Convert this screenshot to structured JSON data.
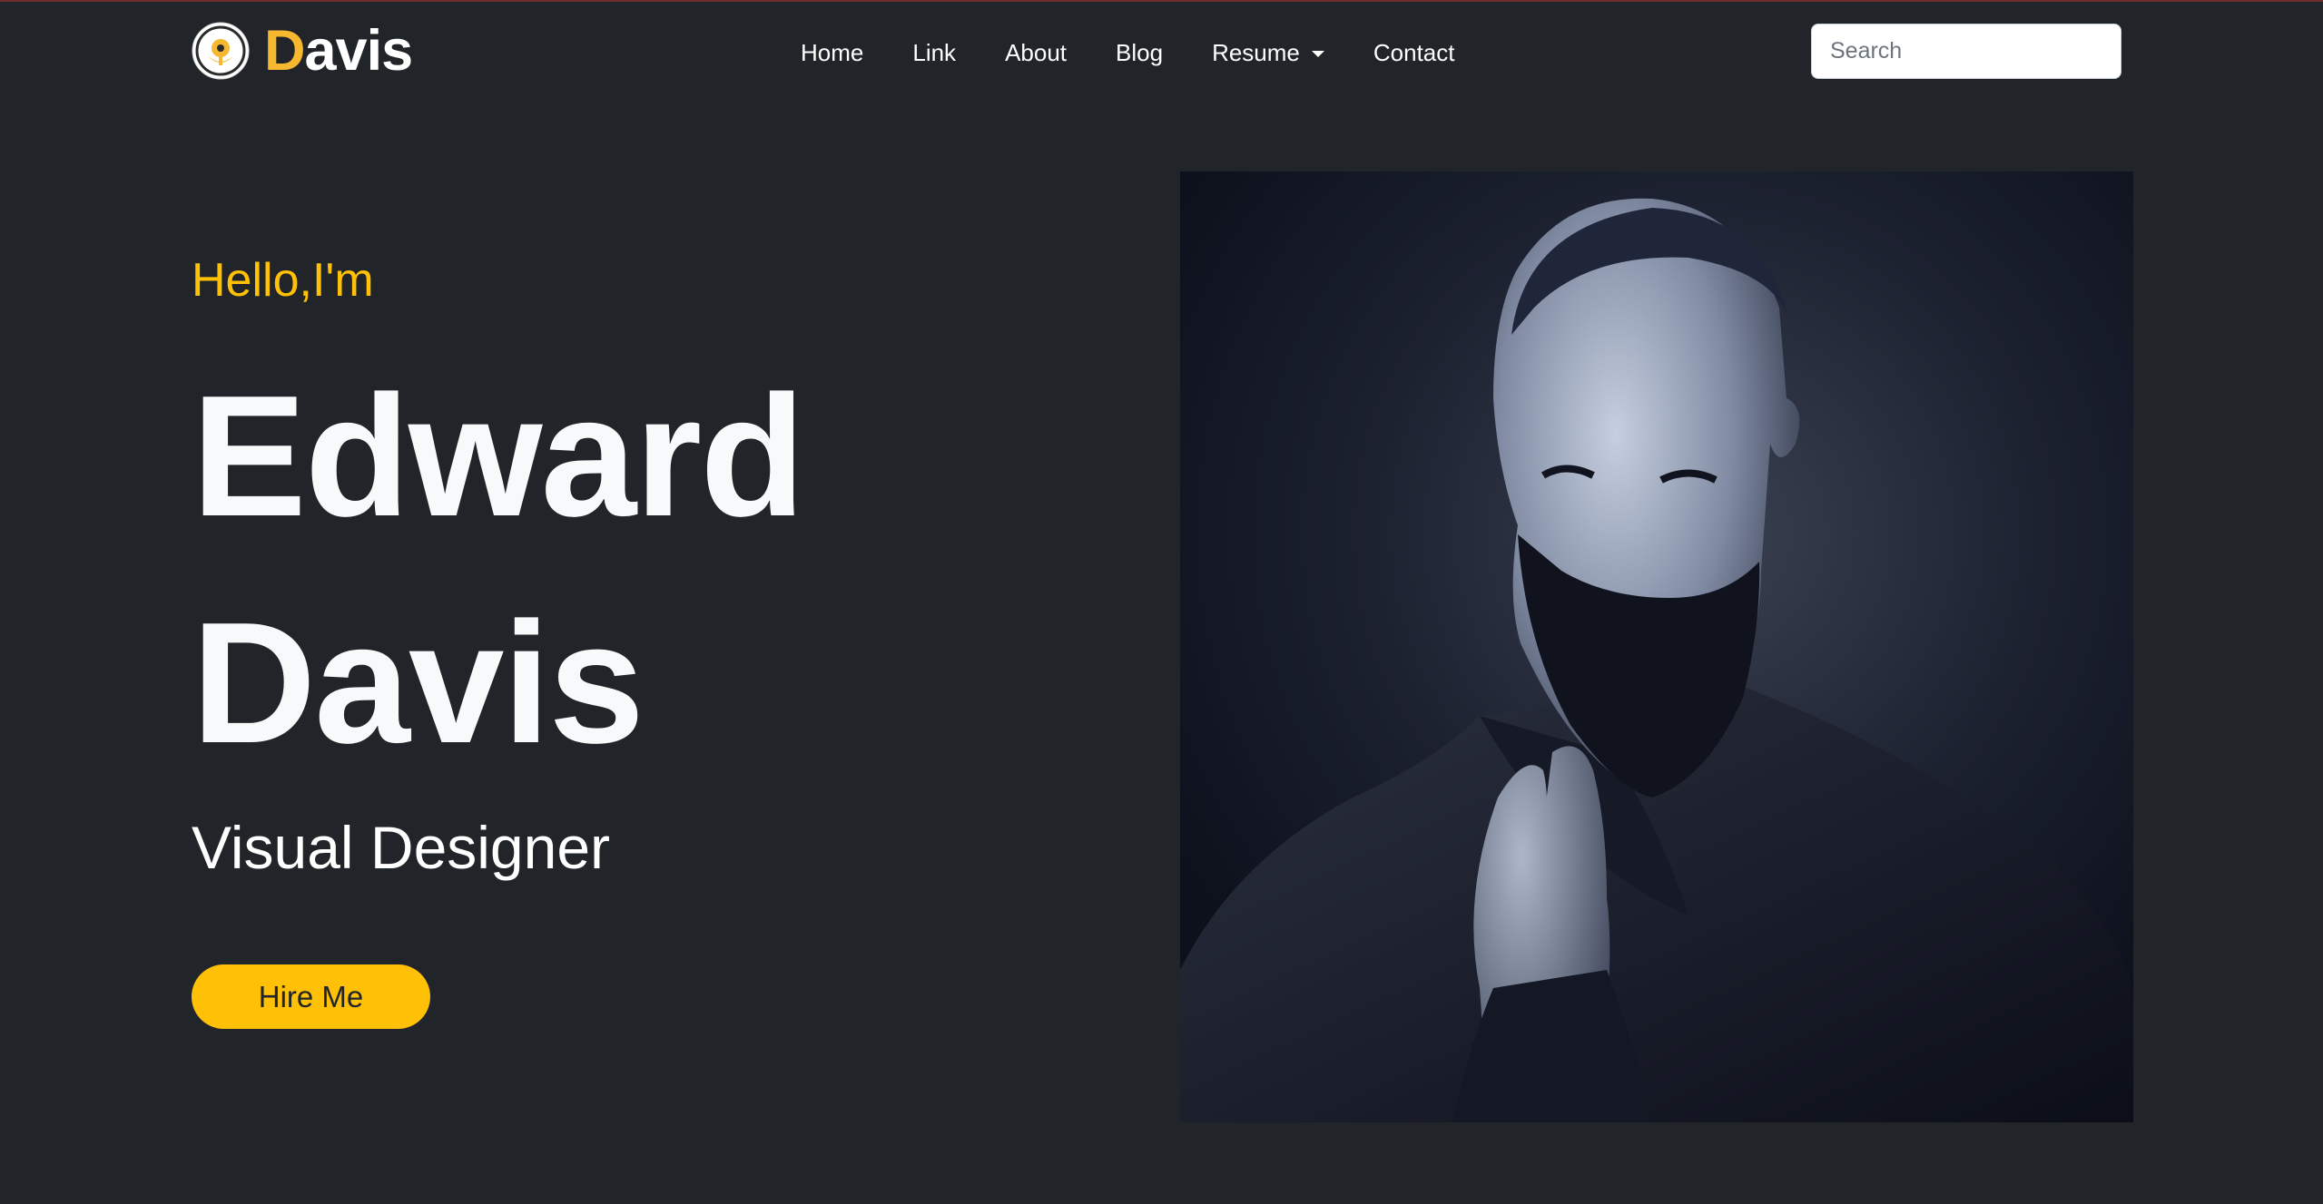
{
  "brand": {
    "first_letter": "D",
    "rest": "avis",
    "logo_icon": "flower-badge-icon",
    "accent_color": "#f5b82e"
  },
  "nav": {
    "home": "Home",
    "link": "Link",
    "about": "About",
    "blog": "Blog",
    "resume": "Resume",
    "contact": "Contact"
  },
  "search": {
    "placeholder": "Search"
  },
  "hero": {
    "greeting": "Hello,I'm",
    "first_name": "Edward",
    "last_name": "Davis",
    "role": "Visual Designer",
    "cta": "Hire Me",
    "cta_color": "#ffc107",
    "background": "#212529"
  },
  "portrait": {
    "subject": "Portrait of a bearded man in a dark coat, hand raised to chin, monochrome blue tone"
  }
}
